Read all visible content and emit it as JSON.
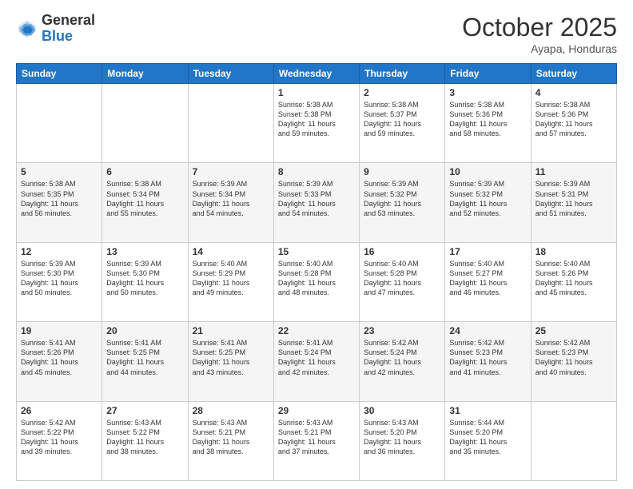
{
  "logo": {
    "general": "General",
    "blue": "Blue"
  },
  "header": {
    "month": "October 2025",
    "location": "Ayapa, Honduras"
  },
  "weekdays": [
    "Sunday",
    "Monday",
    "Tuesday",
    "Wednesday",
    "Thursday",
    "Friday",
    "Saturday"
  ],
  "weeks": [
    [
      {
        "day": "",
        "text": ""
      },
      {
        "day": "",
        "text": ""
      },
      {
        "day": "",
        "text": ""
      },
      {
        "day": "1",
        "text": "Sunrise: 5:38 AM\nSunset: 5:38 PM\nDaylight: 11 hours\nand 59 minutes."
      },
      {
        "day": "2",
        "text": "Sunrise: 5:38 AM\nSunset: 5:37 PM\nDaylight: 11 hours\nand 59 minutes."
      },
      {
        "day": "3",
        "text": "Sunrise: 5:38 AM\nSunset: 5:36 PM\nDaylight: 11 hours\nand 58 minutes."
      },
      {
        "day": "4",
        "text": "Sunrise: 5:38 AM\nSunset: 5:36 PM\nDaylight: 11 hours\nand 57 minutes."
      }
    ],
    [
      {
        "day": "5",
        "text": "Sunrise: 5:38 AM\nSunset: 5:35 PM\nDaylight: 11 hours\nand 56 minutes."
      },
      {
        "day": "6",
        "text": "Sunrise: 5:38 AM\nSunset: 5:34 PM\nDaylight: 11 hours\nand 55 minutes."
      },
      {
        "day": "7",
        "text": "Sunrise: 5:39 AM\nSunset: 5:34 PM\nDaylight: 11 hours\nand 54 minutes."
      },
      {
        "day": "8",
        "text": "Sunrise: 5:39 AM\nSunset: 5:33 PM\nDaylight: 11 hours\nand 54 minutes."
      },
      {
        "day": "9",
        "text": "Sunrise: 5:39 AM\nSunset: 5:32 PM\nDaylight: 11 hours\nand 53 minutes."
      },
      {
        "day": "10",
        "text": "Sunrise: 5:39 AM\nSunset: 5:32 PM\nDaylight: 11 hours\nand 52 minutes."
      },
      {
        "day": "11",
        "text": "Sunrise: 5:39 AM\nSunset: 5:31 PM\nDaylight: 11 hours\nand 51 minutes."
      }
    ],
    [
      {
        "day": "12",
        "text": "Sunrise: 5:39 AM\nSunset: 5:30 PM\nDaylight: 11 hours\nand 50 minutes."
      },
      {
        "day": "13",
        "text": "Sunrise: 5:39 AM\nSunset: 5:30 PM\nDaylight: 11 hours\nand 50 minutes."
      },
      {
        "day": "14",
        "text": "Sunrise: 5:40 AM\nSunset: 5:29 PM\nDaylight: 11 hours\nand 49 minutes."
      },
      {
        "day": "15",
        "text": "Sunrise: 5:40 AM\nSunset: 5:28 PM\nDaylight: 11 hours\nand 48 minutes."
      },
      {
        "day": "16",
        "text": "Sunrise: 5:40 AM\nSunset: 5:28 PM\nDaylight: 11 hours\nand 47 minutes."
      },
      {
        "day": "17",
        "text": "Sunrise: 5:40 AM\nSunset: 5:27 PM\nDaylight: 11 hours\nand 46 minutes."
      },
      {
        "day": "18",
        "text": "Sunrise: 5:40 AM\nSunset: 5:26 PM\nDaylight: 11 hours\nand 45 minutes."
      }
    ],
    [
      {
        "day": "19",
        "text": "Sunrise: 5:41 AM\nSunset: 5:26 PM\nDaylight: 11 hours\nand 45 minutes."
      },
      {
        "day": "20",
        "text": "Sunrise: 5:41 AM\nSunset: 5:25 PM\nDaylight: 11 hours\nand 44 minutes."
      },
      {
        "day": "21",
        "text": "Sunrise: 5:41 AM\nSunset: 5:25 PM\nDaylight: 11 hours\nand 43 minutes."
      },
      {
        "day": "22",
        "text": "Sunrise: 5:41 AM\nSunset: 5:24 PM\nDaylight: 11 hours\nand 42 minutes."
      },
      {
        "day": "23",
        "text": "Sunrise: 5:42 AM\nSunset: 5:24 PM\nDaylight: 11 hours\nand 42 minutes."
      },
      {
        "day": "24",
        "text": "Sunrise: 5:42 AM\nSunset: 5:23 PM\nDaylight: 11 hours\nand 41 minutes."
      },
      {
        "day": "25",
        "text": "Sunrise: 5:42 AM\nSunset: 5:23 PM\nDaylight: 11 hours\nand 40 minutes."
      }
    ],
    [
      {
        "day": "26",
        "text": "Sunrise: 5:42 AM\nSunset: 5:22 PM\nDaylight: 11 hours\nand 39 minutes."
      },
      {
        "day": "27",
        "text": "Sunrise: 5:43 AM\nSunset: 5:22 PM\nDaylight: 11 hours\nand 38 minutes."
      },
      {
        "day": "28",
        "text": "Sunrise: 5:43 AM\nSunset: 5:21 PM\nDaylight: 11 hours\nand 38 minutes."
      },
      {
        "day": "29",
        "text": "Sunrise: 5:43 AM\nSunset: 5:21 PM\nDaylight: 11 hours\nand 37 minutes."
      },
      {
        "day": "30",
        "text": "Sunrise: 5:43 AM\nSunset: 5:20 PM\nDaylight: 11 hours\nand 36 minutes."
      },
      {
        "day": "31",
        "text": "Sunrise: 5:44 AM\nSunset: 5:20 PM\nDaylight: 11 hours\nand 35 minutes."
      },
      {
        "day": "",
        "text": ""
      }
    ]
  ]
}
